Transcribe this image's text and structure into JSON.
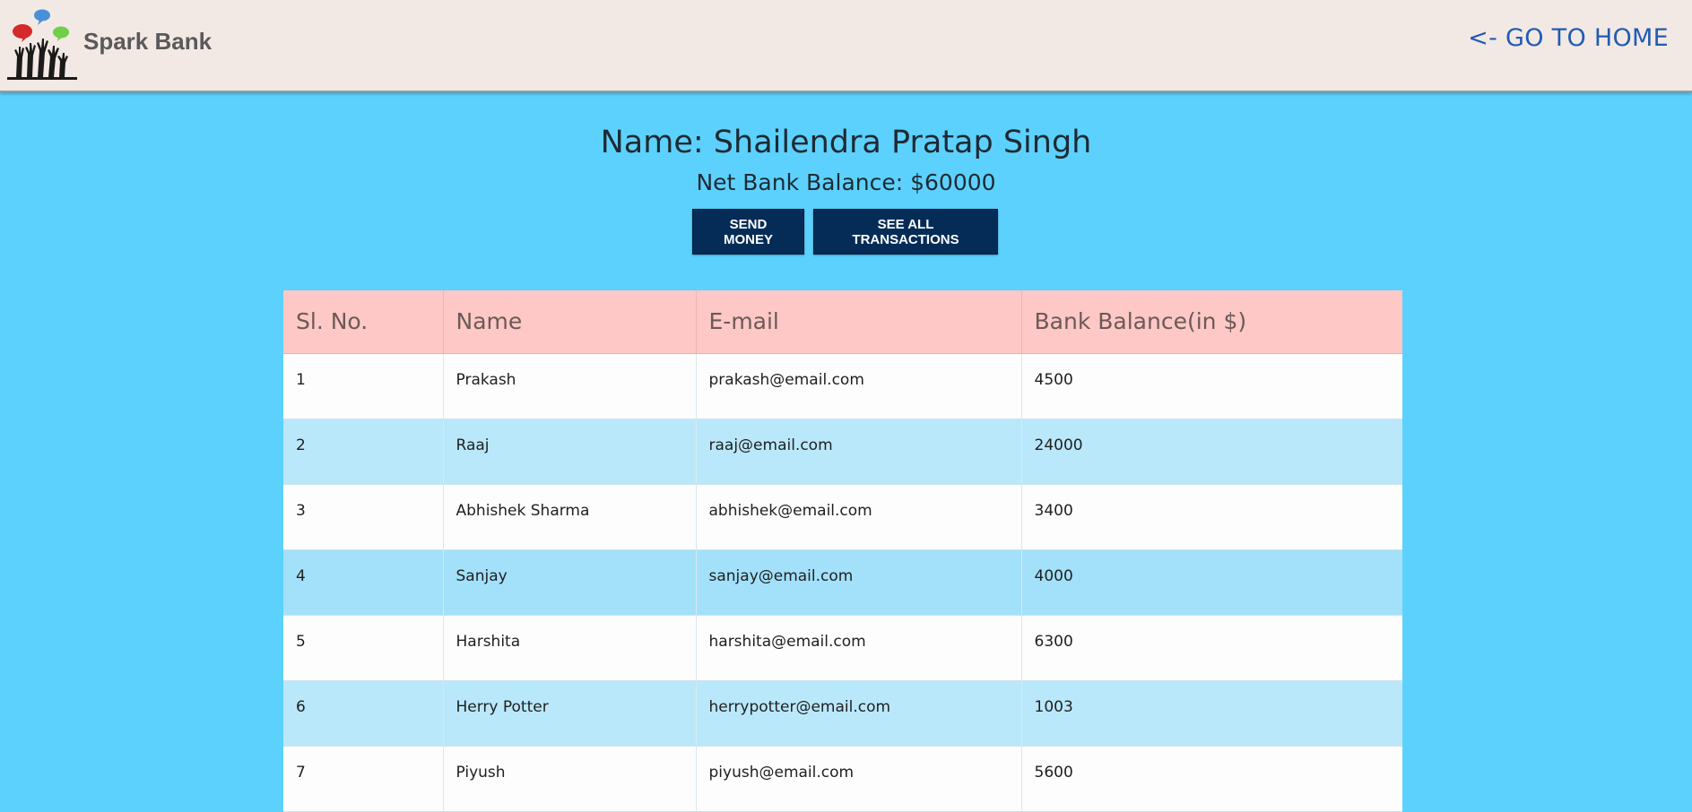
{
  "header": {
    "brand_name": "Spark Bank",
    "home_link": "<- GO TO HOME",
    "logo_icon": "hands-with-speech-bubbles-logo"
  },
  "profile": {
    "name": "Name: Shailendra Pratap Singh",
    "balance": "Net Bank Balance: $60000"
  },
  "actions": {
    "send_money": "SEND MONEY",
    "see_transactions": "SEE ALL TRANSACTIONS"
  },
  "table": {
    "columns": [
      "Sl. No.",
      "Name",
      "E-mail",
      "Bank Balance(in $)"
    ],
    "rows": [
      {
        "sl": "1",
        "name": "Prakash",
        "email": "prakash@email.com",
        "balance": "4500"
      },
      {
        "sl": "2",
        "name": "Raaj",
        "email": "raaj@email.com",
        "balance": "24000"
      },
      {
        "sl": "3",
        "name": "Abhishek Sharma",
        "email": "abhishek@email.com",
        "balance": "3400"
      },
      {
        "sl": "4",
        "name": "Sanjay",
        "email": "sanjay@email.com",
        "balance": "4000"
      },
      {
        "sl": "5",
        "name": "Harshita",
        "email": "harshita@email.com",
        "balance": "6300"
      },
      {
        "sl": "6",
        "name": "Herry Potter",
        "email": "herrypotter@email.com",
        "balance": "1003"
      },
      {
        "sl": "7",
        "name": "Piyush",
        "email": "piyush@email.com",
        "balance": "5600"
      }
    ]
  },
  "colors": {
    "page_background": "#5dd1fd",
    "navbar_background": "#f3e9e4",
    "button_background": "#052c57",
    "table_header_background": "#fdc8c5",
    "row_light": "#fdfdfd",
    "row_blue": "#bae8fb",
    "link_color": "#1f5cb4"
  }
}
